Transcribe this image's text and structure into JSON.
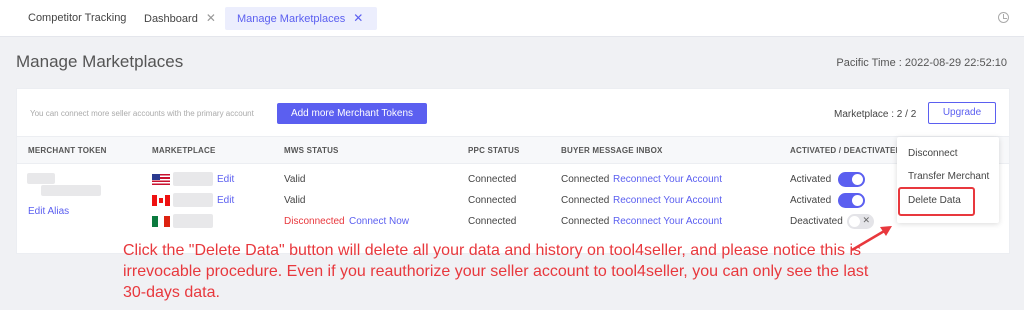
{
  "tabs": [
    {
      "label": "Competitor Tracking"
    },
    {
      "label": "Dashboard",
      "close": "✕"
    },
    {
      "label": "Manage Marketplaces",
      "close": "✕"
    }
  ],
  "header": {
    "title": "Manage Marketplaces",
    "pacific_time": "Pacific Time :  2022-08-29 22:52:10"
  },
  "toolbar": {
    "hint": "You can connect more seller accounts with the primary account",
    "add_button": "Add more Merchant Tokens",
    "marketplace_count": "Marketplace : 2 / 2",
    "upgrade_button": "Upgrade"
  },
  "table": {
    "columns": [
      "MERCHANT TOKEN",
      "MARKETPLACE",
      "MWS STATUS",
      "PPC STATUS",
      "BUYER MESSAGE INBOX",
      "ACTIVATED / DEACTIVATED"
    ],
    "edit_alias": "Edit Alias",
    "rows": [
      {
        "flag": "us",
        "edit": "Edit",
        "mws": "Valid",
        "ppc": "Connected",
        "inbox": "Connected",
        "inbox_link": "Reconnect Your Account",
        "state": "Activated",
        "on": true
      },
      {
        "flag": "ca",
        "edit": "Edit",
        "mws": "Valid",
        "ppc": "Connected",
        "inbox": "Connected",
        "inbox_link": "Reconnect Your Account",
        "state": "Activated",
        "on": true
      },
      {
        "flag": "mx",
        "mws": "Disconnected",
        "mws_link": "Connect Now",
        "ppc": "Connected",
        "inbox": "Connected",
        "inbox_link": "Reconnect Your Account",
        "state": "Deactivated",
        "on": false,
        "toggle_mark": "✕"
      }
    ]
  },
  "menu": {
    "items": [
      "Disconnect",
      "Transfer Merchant",
      "Delete Data"
    ]
  },
  "annotation": {
    "note": "Click the \"Delete Data\" button will delete all your data and history on tool4seller, and please notice this is irrevocable procedure. Even if you reauthorize your seller account to tool4seller, you can only see the last 30-days data."
  },
  "colors": {
    "accent": "#5b5ff0",
    "danger": "#e8383d"
  }
}
